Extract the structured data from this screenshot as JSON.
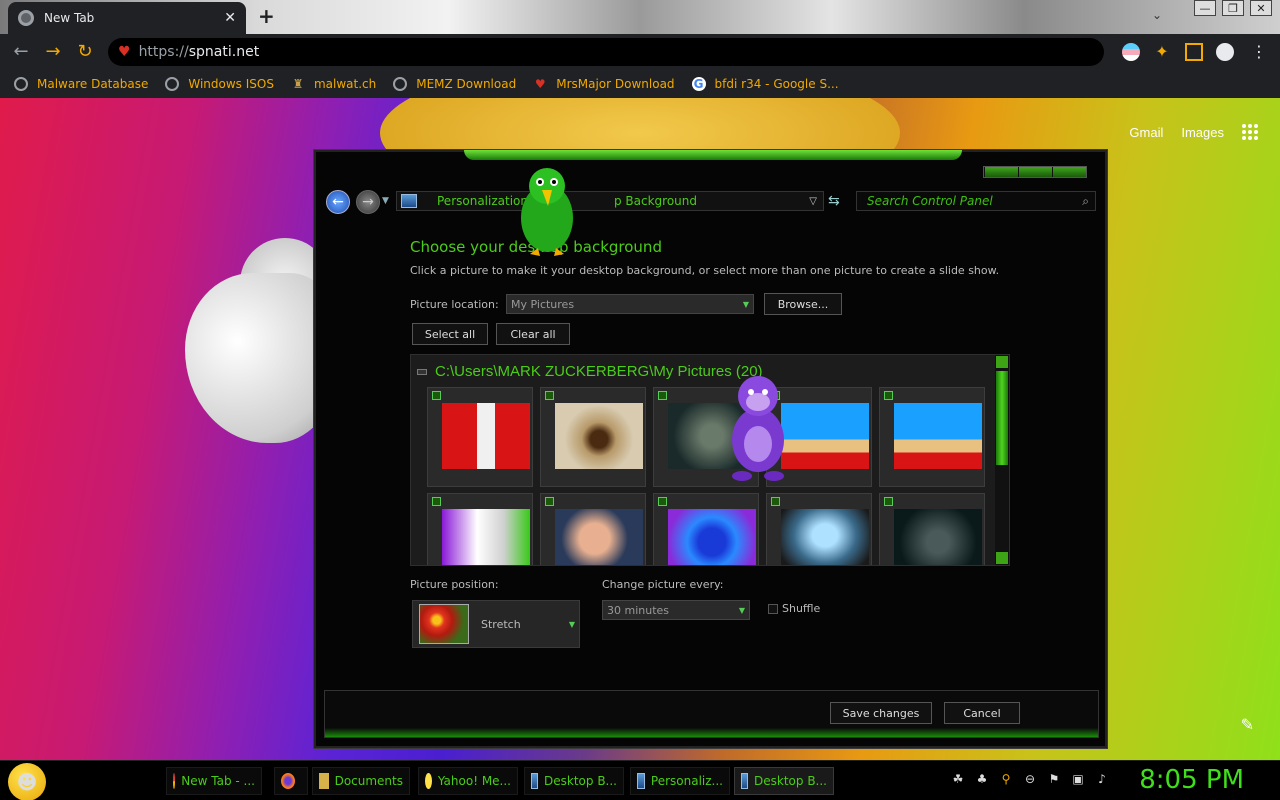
{
  "browser": {
    "tab_title": "New Tab",
    "tab_close": "✕",
    "new_tab": "+",
    "window_controls": [
      "—",
      "❐",
      "✕"
    ],
    "tab_search": "⌄",
    "url_scheme": "https://",
    "url_host": "spnati.net",
    "bookmarks": [
      {
        "label": "Malware Database",
        "icon": "globe-icon"
      },
      {
        "label": "Windows ISOS",
        "icon": "globe-icon"
      },
      {
        "label": "malwat.ch",
        "icon": "man-icon"
      },
      {
        "label": "MEMZ Download",
        "icon": "globe-icon"
      },
      {
        "label": "MrsMajor Download",
        "icon": "heart-icon"
      },
      {
        "label": "bfdi r34 - Google S...",
        "icon": "google-icon"
      }
    ]
  },
  "google": {
    "gmail": "Gmail",
    "images": "Images"
  },
  "control_panel": {
    "address_start": "Personalization",
    "address_end": "p Background",
    "search_placeholder": "Search Control Panel",
    "heading": "Choose your desktop background",
    "subtext": "Click a picture to make it your desktop background, or select more than one picture to create a slide show.",
    "picture_location_label": "Picture location:",
    "picture_location_value": "My Pictures",
    "browse": "Browse...",
    "select_all": "Select all",
    "clear_all": "Clear all",
    "folder_path": "C:\\Users\\MARK ZUCKERBERG\\My Pictures (20)",
    "picture_position_label": "Picture position:",
    "picture_position_value": "Stretch",
    "change_every_label": "Change picture every:",
    "change_every_value": "30 minutes",
    "shuffle": "Shuffle",
    "save": "Save changes",
    "cancel": "Cancel"
  },
  "taskbar": {
    "tasks": [
      {
        "label": "New Tab - ...",
        "icon": "chrome-icon"
      },
      {
        "label": "",
        "icon": "firefox-icon"
      },
      {
        "label": "Documents",
        "icon": "folder-icon"
      },
      {
        "label": "Yahoo! Me...",
        "icon": "yahoo-icon"
      },
      {
        "label": "Desktop B...",
        "icon": "monitor-icon"
      },
      {
        "label": "Personaliz...",
        "icon": "monitor-icon"
      },
      {
        "label": "Desktop B...",
        "icon": "monitor-icon"
      }
    ],
    "clock": "8:05 PM"
  },
  "colors": {
    "accent_green": "#4ccc1a",
    "bookmark_text": "#f2a900"
  }
}
